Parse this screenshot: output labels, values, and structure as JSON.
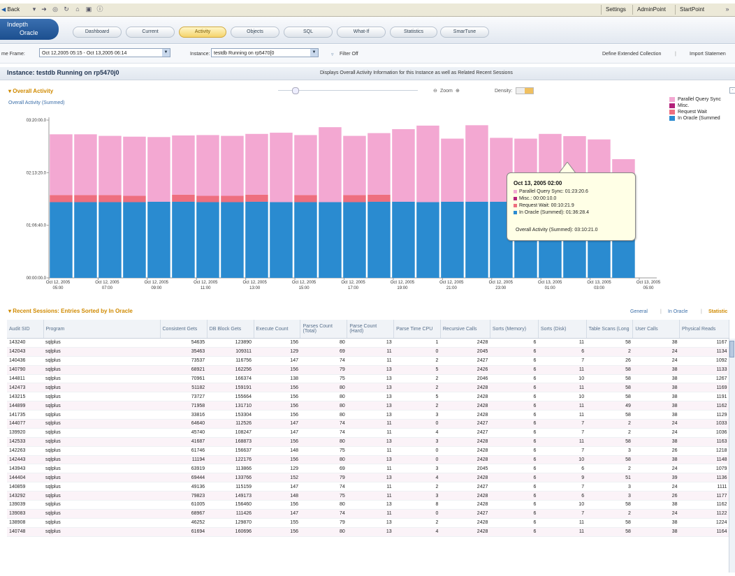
{
  "toolbar": {
    "back_label": "Back",
    "settings": "Settings",
    "admin_point": "AdminPoint",
    "start_point": "StartPoint"
  },
  "brand": {
    "line1": "Indepth",
    "line2": "Oracle"
  },
  "tabs": [
    {
      "label": "Dashboard"
    },
    {
      "label": "Current"
    },
    {
      "label": "Activity"
    },
    {
      "label": "Objects"
    },
    {
      "label": "SQL"
    },
    {
      "label": "What-If"
    },
    {
      "label": "Statistics"
    },
    {
      "label": "SmarTune"
    }
  ],
  "filter": {
    "time_frame_label": "me Frame:",
    "time_frame_value": "Oct 12,2005 05:15 - Oct 13,2005 06:14",
    "instance_label": "Instance:",
    "instance_value": "testdb Running on rp5470[0",
    "filter_label": "Filter Off",
    "define_link": "Define Extended Collection",
    "import_link": "Import Statemen"
  },
  "instance": {
    "title": "Instance: testdb Running on rp5470j0",
    "description": "Displays Overall Activity Information for this Instance as well as Related Recent Sessions"
  },
  "overall": {
    "title": "Overall Activity",
    "subtitle": "Overall Activity (Summed)",
    "zoom_label": "Zoom",
    "density_label": "Density:"
  },
  "tooltip": {
    "title": "Oct 13, 2005 02:00",
    "rows": [
      {
        "text": "Parallel Query Sync: 01:23:20.6",
        "color": "#f3a8d2"
      },
      {
        "text": "Misc.: 00:00:10.0",
        "color": "#b3207a"
      },
      {
        "text": "Request Wait: 00:10:21.9",
        "color": "#ee6f7f"
      },
      {
        "text": "In Oracle (Summed): 01:36:28.4",
        "color": "#2a8bd0"
      }
    ],
    "total": "Overall Activity (Summed): 03:10:21.0"
  },
  "chart_data": {
    "type": "bar",
    "stacked": true,
    "title": "Overall Activity (Summed)",
    "y_tick_labels": [
      "03:20:00.0",
      "02:13:20.0",
      "01:06:40.0",
      "00:00:00.0"
    ],
    "ylim": [
      0,
      200
    ],
    "y_unit": "minutes",
    "x_tick_labels": [
      "Oct 12, 2005 05:00",
      "Oct 12, 2005 07:00",
      "Oct 12, 2005 09:00",
      "Oct 12, 2005 11:00",
      "Oct 12, 2005 13:00",
      "Oct 12, 2005 15:00",
      "Oct 12, 2005 17:00",
      "Oct 12, 2005 19:00",
      "Oct 12, 2005 21:00",
      "Oct 12, 2005 23:00",
      "Oct 13, 2005 01:00",
      "Oct 13, 2005 03:00",
      "Oct 13, 2005 05:00"
    ],
    "series": [
      {
        "name": "In Oracle (Summed)",
        "color": "#2a8bd0",
        "values": [
          96,
          96,
          96,
          96,
          96.5,
          96.5,
          96,
          96,
          96.5,
          96,
          96,
          96,
          96,
          96.5,
          96.5,
          96,
          96.5,
          96.5,
          96.5,
          96.5,
          96.5,
          96.5,
          96.5,
          96.5
        ]
      },
      {
        "name": "Request Wait",
        "color": "#ee6f7f",
        "values": [
          9,
          9,
          9,
          8,
          0,
          9,
          8,
          8,
          9,
          0,
          9,
          0,
          9,
          9,
          0,
          0,
          0,
          0,
          0,
          0,
          0,
          0,
          0,
          0
        ]
      },
      {
        "name": "Misc.",
        "color": "#b3207a",
        "values": [
          0,
          0,
          0,
          0,
          0,
          0,
          0,
          0,
          0,
          0,
          0,
          0,
          0,
          0,
          0,
          0,
          0,
          0,
          0,
          0,
          0,
          0.2,
          0,
          0
        ]
      },
      {
        "name": "Parallel Query Sync",
        "color": "#f3a8d2",
        "values": [
          77,
          77,
          75,
          75,
          82,
          75,
          77,
          76,
          77,
          88,
          76,
          95,
          75,
          78,
          92,
          97,
          80,
          97,
          81,
          80,
          86,
          83,
          79,
          54
        ]
      }
    ],
    "legend": [
      "Parallel Query Sync",
      "Misc.",
      "Request Wait",
      "In Oracle (Summed)"
    ],
    "legend_position": "right",
    "legend_visible_labels": [
      "Parallel Query Sync",
      "Misc.",
      "Request Wait",
      "In Oracle (Summed"
    ],
    "grid": false
  },
  "recent": {
    "title": "Recent Sessions: Entries Sorted by In Oracle",
    "view_general": "General",
    "view_in_oracle": "In Oracle",
    "view_statistics": "Statistic",
    "columns": [
      "Audit SID",
      "Program",
      "Consistent Gets",
      "DB Block Gets",
      "Execute Count",
      "Parses Count (Total)",
      "Parse Count (Hard)",
      "Parse Time CPU",
      "Recursive Calls",
      "Sorts (Memory)",
      "Sorts (Disk)",
      "Table Scans (Long",
      "User Calls",
      "Physical Reads"
    ],
    "rows": [
      [
        "143240",
        "sqlplus",
        "54635",
        "123890",
        "156",
        "80",
        "13",
        "1",
        "2428",
        "6",
        "11",
        "58",
        "38",
        "1167"
      ],
      [
        "142043",
        "sqlplus",
        "35463",
        "109311",
        "129",
        "69",
        "11",
        "0",
        "2045",
        "6",
        "6",
        "2",
        "24",
        "1134"
      ],
      [
        "140436",
        "sqlplus",
        "73537",
        "116756",
        "147",
        "74",
        "11",
        "2",
        "2427",
        "6",
        "7",
        "26",
        "24",
        "1092"
      ],
      [
        "140790",
        "sqlplus",
        "68921",
        "162256",
        "156",
        "79",
        "13",
        "5",
        "2426",
        "6",
        "11",
        "58",
        "38",
        "1133"
      ],
      [
        "144811",
        "sqlplus",
        "70961",
        "166374",
        "138",
        "75",
        "13",
        "2",
        "2046",
        "6",
        "10",
        "58",
        "38",
        "1267"
      ],
      [
        "142473",
        "sqlplus",
        "51182",
        "159191",
        "156",
        "80",
        "13",
        "2",
        "2428",
        "6",
        "11",
        "58",
        "38",
        "1169"
      ],
      [
        "143215",
        "sqlplus",
        "73727",
        "155664",
        "156",
        "80",
        "13",
        "5",
        "2428",
        "6",
        "10",
        "58",
        "38",
        "1191"
      ],
      [
        "144899",
        "sqlplus",
        "71958",
        "131710",
        "156",
        "80",
        "13",
        "2",
        "2428",
        "6",
        "11",
        "49",
        "38",
        "1162"
      ],
      [
        "141735",
        "sqlplus",
        "33816",
        "153304",
        "156",
        "80",
        "13",
        "3",
        "2428",
        "6",
        "11",
        "58",
        "38",
        "1129"
      ],
      [
        "144077",
        "sqlplus",
        "64640",
        "112526",
        "147",
        "74",
        "11",
        "0",
        "2427",
        "6",
        "7",
        "2",
        "24",
        "1033"
      ],
      [
        "139920",
        "sqlplus",
        "45740",
        "108247",
        "147",
        "74",
        "11",
        "4",
        "2427",
        "6",
        "7",
        "2",
        "24",
        "1036"
      ],
      [
        "142533",
        "sqlplus",
        "41687",
        "168873",
        "156",
        "80",
        "13",
        "3",
        "2428",
        "6",
        "11",
        "58",
        "38",
        "1163"
      ],
      [
        "142263",
        "sqlplus",
        "61746",
        "156637",
        "148",
        "75",
        "11",
        "0",
        "2428",
        "6",
        "7",
        "3",
        "26",
        "1218"
      ],
      [
        "142443",
        "sqlplus",
        "11194",
        "122176",
        "156",
        "80",
        "13",
        "0",
        "2428",
        "6",
        "10",
        "58",
        "38",
        "1148"
      ],
      [
        "143943",
        "sqlplus",
        "63919",
        "113866",
        "129",
        "69",
        "11",
        "3",
        "2045",
        "6",
        "6",
        "2",
        "24",
        "1079"
      ],
      [
        "144404",
        "sqlplus",
        "69444",
        "133766",
        "152",
        "79",
        "13",
        "4",
        "2428",
        "6",
        "9",
        "51",
        "39",
        "1136"
      ],
      [
        "140859",
        "sqlplus",
        "49136",
        "115159",
        "147",
        "74",
        "11",
        "2",
        "2427",
        "6",
        "7",
        "3",
        "24",
        "1111"
      ],
      [
        "143292",
        "sqlplus",
        "79823",
        "149173",
        "148",
        "75",
        "11",
        "3",
        "2428",
        "6",
        "6",
        "3",
        "26",
        "1177"
      ],
      [
        "139039",
        "sqlplus",
        "61005",
        "156460",
        "156",
        "80",
        "13",
        "8",
        "2428",
        "6",
        "10",
        "58",
        "38",
        "1162"
      ],
      [
        "139083",
        "sqlplus",
        "68967",
        "111426",
        "147",
        "74",
        "11",
        "0",
        "2427",
        "6",
        "7",
        "2",
        "24",
        "1122"
      ],
      [
        "138908",
        "sqlplus",
        "46252",
        "129870",
        "155",
        "79",
        "13",
        "2",
        "2428",
        "6",
        "11",
        "58",
        "38",
        "1224"
      ],
      [
        "140748",
        "sqlplus",
        "61694",
        "160696",
        "156",
        "80",
        "13",
        "4",
        "2428",
        "6",
        "11",
        "58",
        "38",
        "1164"
      ]
    ]
  }
}
